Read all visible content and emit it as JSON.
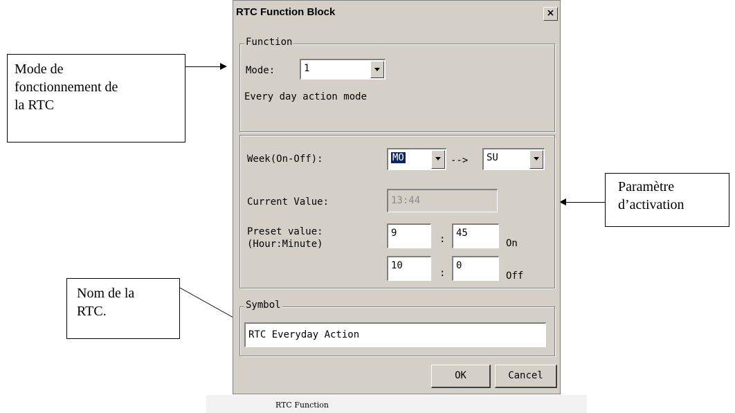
{
  "dialog": {
    "title": "RTC Function Block",
    "close_glyph": "×",
    "function_group": {
      "legend": "Function",
      "mode_label": "Mode:",
      "mode_value": "1",
      "mode_description": "Every day action mode"
    },
    "week_label": "Week(On-Off):",
    "week_from": "MO",
    "week_arrow": "-->",
    "week_to": "SU",
    "current_value_label": "Current Value:",
    "current_value": "13:44",
    "preset_label_1": "Preset value:",
    "preset_label_2": "(Hour:Minute)",
    "on_hour": "9",
    "on_minute": "45",
    "on_label": "On",
    "off_hour": "10",
    "off_minute": "0",
    "off_label": "Off",
    "colon": ":",
    "symbol_group": {
      "legend": "Symbol",
      "value": "RTC Everyday Action"
    },
    "ok_label": "OK",
    "cancel_label": "Cancel"
  },
  "annotations": {
    "mode_callout": [
      "Mode de",
      "fonctionnement de",
      "la RTC"
    ],
    "param_callout": [
      "Paramètre",
      "d’activation"
    ],
    "name_callout": [
      "Nom de la",
      "RTC."
    ]
  },
  "caption": "RTC Function",
  "icons": {
    "close": "close-icon",
    "dropdown": "chevron-down-icon"
  },
  "colors": {
    "dialog_bg": "#d4d0c8",
    "selection": "#0a246a"
  }
}
